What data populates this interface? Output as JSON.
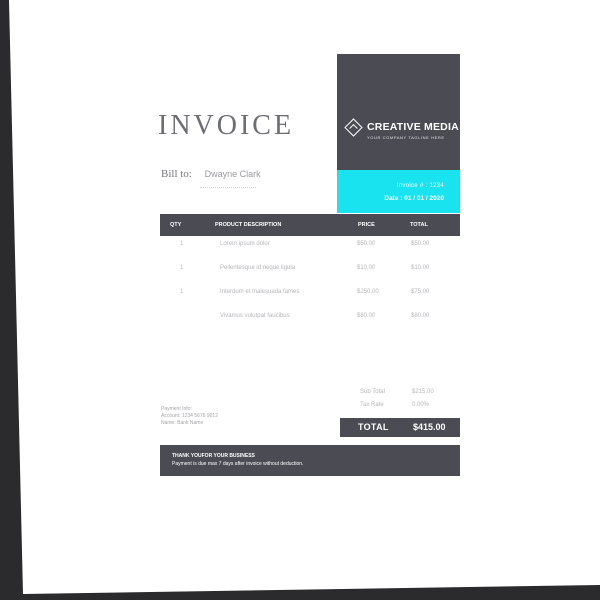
{
  "invoice": {
    "title": "INVOICE",
    "bill_to_label": "Bill to:",
    "bill_to_name": "Dwayne Clark"
  },
  "brand": {
    "company": "CREATIVE MEDIA",
    "tagline": "YOUR COMPANY TAGLINE HERE",
    "invoice_no": "Invoice # : 1234",
    "date": "Date : 01 / 01 / 2020"
  },
  "table": {
    "headers": {
      "qty": "QTY",
      "description": "PRODUCT DESCRIPTION",
      "price": "PRICE",
      "total": "TOTAL"
    },
    "rows": [
      {
        "qty": "1",
        "description": "Lorem ipsum dolor",
        "price": "$50.00",
        "total": "$50.00"
      },
      {
        "qty": "1",
        "description": "Pellentesque id neque ligula",
        "price": "$10.00",
        "total": "$10.00"
      },
      {
        "qty": "1",
        "description": "Interdum et malesuada fames",
        "price": "$250.00",
        "total": "$75.00"
      },
      {
        "qty": "",
        "description": "Vivamus volutpat faucibus",
        "price": "$80.00",
        "total": "$80.00"
      }
    ]
  },
  "summary": {
    "subtotal_label": "Sub Total",
    "subtotal_value": "$215.00",
    "tax_label": "Tax Rate",
    "tax_value": "0.00%",
    "total_label": "TOTAL",
    "total_value": "$415.00"
  },
  "payment": {
    "line1": "Payment Info:",
    "line2": "Account: 1234 5678 9012",
    "line3": "Name: Bank Name"
  },
  "footer": {
    "thanks": "THANK YOUFOR YOUR BUSINESS",
    "terms": "Payment is due max 7 days after invoice without deduction."
  },
  "colors": {
    "dark": "#4b4c53",
    "accent": "#19e3ef",
    "background": "#2b2b2d"
  }
}
